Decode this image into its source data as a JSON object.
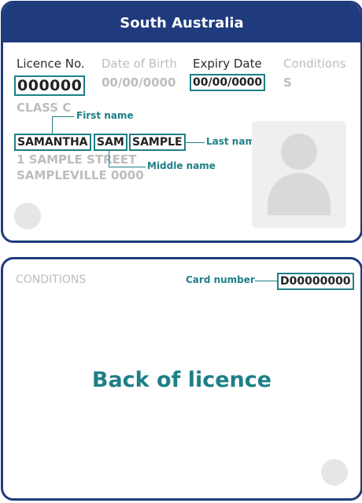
{
  "front": {
    "state": "South Australia",
    "licence_no": {
      "label": "Licence No.",
      "value": "000000"
    },
    "dob": {
      "label": "Date of Birth",
      "value": "00/00/0000"
    },
    "expiry": {
      "label": "Expiry Date",
      "value": "00/00/0000"
    },
    "conditions": {
      "label": "Conditions",
      "value": "S"
    },
    "class": "CLASS C",
    "first_name": "SAMANTHA",
    "middle_name": "SAM",
    "last_name": "SAMPLE",
    "address_line1": "1 SAMPLE STREET",
    "address_line2": "SAMPLEVILLE 0000"
  },
  "annotations": {
    "first_name": "First name",
    "middle_name": "Middle name",
    "last_name": "Last name",
    "card_number": "Card number"
  },
  "back": {
    "conditions_label": "CONDITIONS",
    "card_number": "D00000000",
    "title": "Back of licence"
  },
  "colors": {
    "header_blue": "#1f3a7d",
    "highlight_teal": "#1e7f86",
    "placeholder_grey": "#bdbdbd"
  }
}
